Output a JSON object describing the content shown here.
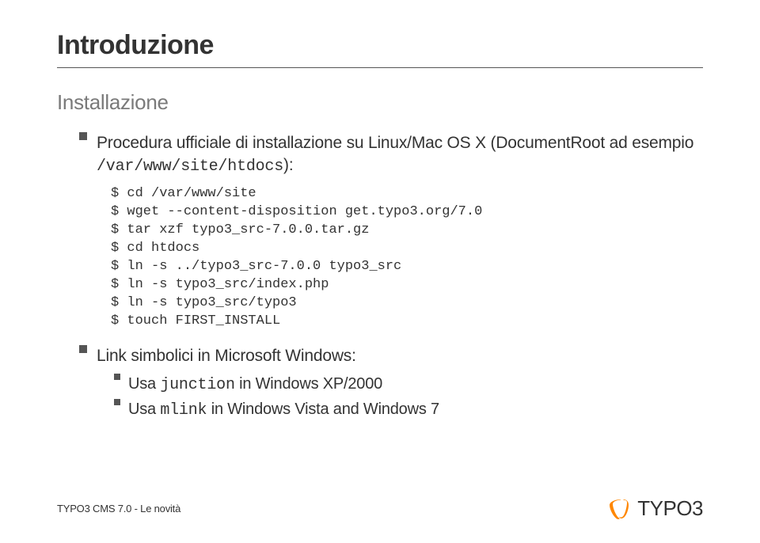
{
  "title": "Introduzione",
  "subtitle": "Installazione",
  "bullet1_prefix": "Procedura ufficiale di installazione su Linux/Mac OS X (DocumentRoot ad esempio ",
  "bullet1_mono": "/var/www/site/htdocs",
  "bullet1_suffix": "):",
  "code": "$ cd /var/www/site\n$ wget --content-disposition get.typo3.org/7.0\n$ tar xzf typo3_src-7.0.0.tar.gz\n$ cd htdocs\n$ ln -s ../typo3_src-7.0.0 typo3_src\n$ ln -s typo3_src/index.php\n$ ln -s typo3_src/typo3\n$ touch FIRST_INSTALL",
  "bullet2": "Link simbolici in Microsoft Windows:",
  "nested1_prefix": "Usa ",
  "nested1_mono": "junction",
  "nested1_suffix": " in Windows XP/2000",
  "nested2_prefix": "Usa ",
  "nested2_mono": "mlink",
  "nested2_suffix": " in Windows Vista and Windows 7",
  "footer": "TYPO3 CMS 7.0 - Le novità",
  "logo": "TYPO3",
  "logo_color": "#ff8700"
}
